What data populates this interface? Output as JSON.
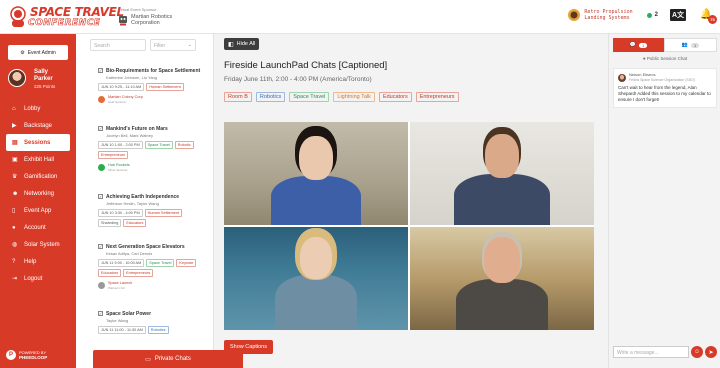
{
  "header": {
    "logo_line1": "SPACE TRAVEL",
    "logo_line2": "CONFERENCE",
    "sponsor_label": "Virtual Event Sponsor",
    "sponsor_name_line1": "Martian Robotics",
    "sponsor_name_line2": "Corporation",
    "brand_line1": "Retro Propulsion",
    "brand_line2": "Landing Systems",
    "points": "2",
    "notifications": "75"
  },
  "sidebar": {
    "event_admin": "Event Admin",
    "user_name_line1": "Sally",
    "user_name_line2": "Parker",
    "user_points": "225 Points",
    "items": [
      {
        "label": "Lobby",
        "icon": "home-icon"
      },
      {
        "label": "Backstage",
        "icon": "video-icon"
      },
      {
        "label": "Sessions",
        "icon": "sessions-icon"
      },
      {
        "label": "Exhibit Hall",
        "icon": "store-icon"
      },
      {
        "label": "Gamification",
        "icon": "trophy-icon"
      },
      {
        "label": "Networking",
        "icon": "people-icon"
      },
      {
        "label": "Event App",
        "icon": "mobile-icon"
      },
      {
        "label": "Account",
        "icon": "user-icon"
      },
      {
        "label": "Solar System",
        "icon": "globe-icon"
      },
      {
        "label": "Help",
        "icon": "help-icon"
      },
      {
        "label": "Logout",
        "icon": "logout-icon"
      }
    ],
    "powered_label": "POWERED BY",
    "powered_brand": "PHEEDLOOP"
  },
  "session_list": {
    "search_placeholder": "Search",
    "filter_placeholder": "Filter",
    "sessions": [
      {
        "title": "Bio-Requirements for Space Settlement",
        "speakers": "Katherine Johnson, Liu Yang",
        "tags": [
          {
            "t": "JUN 10 9:25 - 11:10 AM",
            "c": ""
          },
          {
            "t": "Human Settlement",
            "c": "red"
          }
        ],
        "sponsor": "Martian Colony Corp",
        "sponsor_sub": "Gold Sponsor"
      },
      {
        "title": "Mankind's Future on Mars",
        "speakers": "Jocelyn Bell, Mark Watney",
        "tags": [
          {
            "t": "JUN 10 1:00 - 2:00 PM",
            "c": ""
          },
          {
            "t": "Space Travel",
            "c": "green"
          },
          {
            "t": "Robotic",
            "c": "red"
          },
          {
            "t": "Entrepreneurs",
            "c": "red"
          }
        ],
        "sponsor": "Hub Rockets",
        "sponsor_sub": "Silver Sponsor"
      },
      {
        "title": "Achieving Earth Independence",
        "speakers": "Jefferson Heslin, Taylor Wang",
        "tags": [
          {
            "t": "JUN 10 3:30 - 4:00 PM",
            "c": ""
          },
          {
            "t": "Human Settlement",
            "c": "red"
          },
          {
            "t": "Shareding",
            "c": ""
          },
          {
            "t": "Educators",
            "c": "red"
          }
        ],
        "sponsor": "",
        "sponsor_sub": ""
      },
      {
        "title": "Next Generation Space Elevators",
        "speakers": "Kesav Aditya, Carl Dennis",
        "tags": [
          {
            "t": "JUN 11 9:00 - 10:00 AM",
            "c": ""
          },
          {
            "t": "Space Travel",
            "c": "green"
          },
          {
            "t": "Keynote",
            "c": "red"
          },
          {
            "t": "Educators",
            "c": "red"
          },
          {
            "t": "Entrepreneurs",
            "c": "red"
          }
        ],
        "sponsor": "Space Launch",
        "sponsor_sub": "Platinum 1/2"
      },
      {
        "title": "Space Solar Power",
        "speakers": "Taylor Wang",
        "tags": [
          {
            "t": "JUN 11 11:00 - 11:30 AM",
            "c": ""
          },
          {
            "t": "Robotics",
            "c": "blue"
          }
        ],
        "sponsor": "",
        "sponsor_sub": ""
      }
    ]
  },
  "main": {
    "hide_all": "Hide All",
    "title": "Fireside LaunchPad Chats [Captioned]",
    "time": "Friday June 11th, 2:00 - 4:00 PM (America/Toronto)",
    "tags": [
      {
        "t": "Room B",
        "c": "red"
      },
      {
        "t": "Robotics",
        "c": "blue"
      },
      {
        "t": "Space Travel",
        "c": "green"
      },
      {
        "t": "Lightning Talk",
        "c": "orange"
      },
      {
        "t": "Educators",
        "c": "red"
      },
      {
        "t": "Entrepreneurs",
        "c": "red"
      }
    ],
    "captions_button": "Show Captions",
    "private_chats": "Private Chats"
  },
  "chat": {
    "tab1_count": "1",
    "tab2_count": "1",
    "room_label": "Public Session Chat",
    "msg_author": "Nelson Eliseos",
    "msg_role": "Fellow Space Science Organization (SSO)",
    "msg_text": "Can't wait to hear from the legend, Alan Shepard! Added this session to my calendar to ensure I don't forget!",
    "input_placeholder": "Write a message..."
  },
  "colors": {
    "accent": "#d83a28",
    "green": "#27ae60"
  }
}
